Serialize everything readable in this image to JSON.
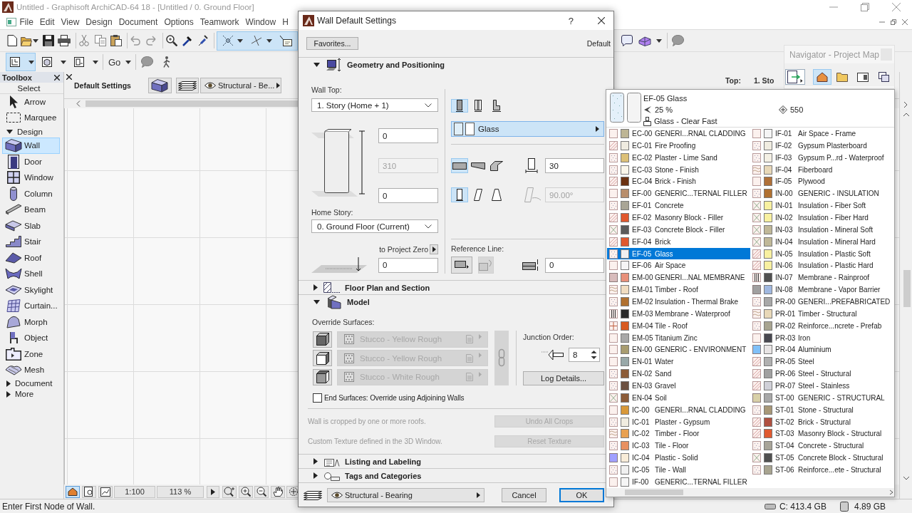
{
  "window": {
    "title": "Untitled - Graphisoft ArchiCAD-64 18 - [Untitled / 0. Ground Floor]"
  },
  "menu_bar": [
    {
      "label": "File"
    },
    {
      "label": "Edit"
    },
    {
      "label": "View"
    },
    {
      "label": "Design"
    },
    {
      "label": "Document"
    },
    {
      "label": "Options"
    },
    {
      "label": "Teamwork"
    },
    {
      "label": "Window"
    },
    {
      "label": "H"
    }
  ],
  "toolbar": {
    "snap_tools_active": true,
    "views": [
      {
        "selected": true
      },
      {
        "selected": false
      },
      {
        "selected": false
      }
    ],
    "go_label": "Go"
  },
  "toolbox": {
    "title": "Toolbox",
    "select_label": "Select",
    "select_tools": [
      {
        "label": "Arrow",
        "selected": false
      },
      {
        "label": "Marquee",
        "selected": false
      }
    ],
    "groups": [
      {
        "label": "Design",
        "expanded": true,
        "tools": [
          {
            "label": "Wall",
            "selected": true
          },
          {
            "label": "Door",
            "selected": false
          },
          {
            "label": "Window",
            "selected": false
          },
          {
            "label": "Column",
            "selected": false
          },
          {
            "label": "Beam",
            "selected": false
          },
          {
            "label": "Slab",
            "selected": false
          },
          {
            "label": "Stair",
            "selected": false
          },
          {
            "label": "Roof",
            "selected": false
          },
          {
            "label": "Shell",
            "selected": false
          },
          {
            "label": "Skylight",
            "selected": false
          },
          {
            "label": "Curtain...",
            "selected": false
          },
          {
            "label": "Morph",
            "selected": false
          },
          {
            "label": "Object",
            "selected": false
          },
          {
            "label": "Zone",
            "selected": false
          },
          {
            "label": "Mesh",
            "selected": false
          }
        ]
      },
      {
        "label": "Document",
        "expanded": false
      },
      {
        "label": "More",
        "expanded": false
      }
    ]
  },
  "info_box": {
    "title": "Default Settings",
    "layer": "Structural - Be...",
    "top_label": "Top:",
    "top_value": "1. Sto"
  },
  "view_controls": {
    "modes": [
      {
        "selected": true
      },
      {
        "selected": false
      },
      {
        "selected": false
      }
    ],
    "scale": "1:100",
    "zoom": "113 %"
  },
  "navigator": {
    "title": "Navigator - Project Map",
    "tabs": [
      {
        "selected": true
      },
      {
        "selected": false
      },
      {
        "selected": false
      },
      {
        "selected": false
      }
    ]
  },
  "status_bar": {
    "message": "Enter First Node of Wall.",
    "disk": "C: 413.4 GB",
    "memory": "4.89 GB"
  },
  "dialog": {
    "title": "Wall Default Settings",
    "help_button": "?",
    "favorites_button": "Favorites...",
    "preset": "Default",
    "sections": [
      {
        "kind": "geometry",
        "title": "Geometry and Positioning",
        "expanded": true,
        "wall_top_label": "Wall Top:",
        "wall_top": "1. Story (Home + 1)",
        "top_offset": {
          "value": "0",
          "disabled": false
        },
        "height": {
          "value": "310",
          "disabled": true
        },
        "bottom_offset": {
          "value": "0",
          "disabled": false
        },
        "home_story_label": "Home Story:",
        "home_story": "0. Ground Floor (Current)",
        "project_zero_label": "to Project Zero",
        "base_elevation": {
          "value": "0",
          "disabled": false
        },
        "structure": [
          {
            "selected": true
          },
          {
            "selected": false
          },
          {
            "selected": false
          }
        ],
        "material": {
          "value": "Glass",
          "open": true
        },
        "profile": [
          {
            "selected": true
          },
          {
            "selected": false
          },
          {
            "selected": false
          }
        ],
        "thickness": {
          "value": "30",
          "disabled": false
        },
        "slant": [
          {
            "selected": true
          },
          {
            "selected": false
          },
          {
            "selected": false
          }
        ],
        "angle": {
          "value": "90.00°",
          "disabled": true
        },
        "reference_line_label": "Reference Line:",
        "reference_offset": {
          "value": "0",
          "disabled": false
        }
      },
      {
        "kind": "floor_plan",
        "title": "Floor Plan and Section",
        "expanded": false
      },
      {
        "kind": "model",
        "title": "Model",
        "expanded": true,
        "override_label": "Override Surfaces:",
        "surfaces": [
          {
            "value": "Stucco - Yellow Rough",
            "disabled": true
          },
          {
            "value": "Stucco - Yellow Rough",
            "disabled": true
          },
          {
            "value": "Stucco - White Rough",
            "disabled": true
          }
        ],
        "junction_label": "Junction Order:",
        "junction_order": "8",
        "log_button": "Log Details...",
        "end_surfaces": {
          "label": "End Surfaces: Override using Adjoining Walls",
          "checked": false
        },
        "notes": [
          {
            "text": "Wall is cropped by one or more roofs.",
            "button": "Undo All Crops",
            "disabled": true
          },
          {
            "text": "Custom Texture defined in the 3D Window.",
            "button": "Reset Texture",
            "disabled": true
          }
        ]
      },
      {
        "kind": "listing",
        "title": "Listing and Labeling",
        "expanded": false
      },
      {
        "kind": "tags",
        "title": "Tags and Categories",
        "expanded": false
      }
    ],
    "footer": {
      "layer": "Structural - Bearing",
      "buttons": [
        {
          "label": "Cancel",
          "default": false
        },
        {
          "label": "OK",
          "default": true
        }
      ]
    }
  },
  "material_popup": {
    "preview": {
      "name": "EF-05 Glass",
      "transparency": "25 %",
      "priority": "550",
      "surface": "Glass - Clear Fast"
    },
    "columns": [
      [
        {
          "code": "EC-00",
          "name": "GENERI...RNAL CLADDING",
          "color": "#bdb594",
          "selected": false
        },
        {
          "code": "EC-01",
          "name": "Fire Proofing",
          "color": "#efebe0",
          "selected": false
        },
        {
          "code": "EC-02",
          "name": "Plaster - Lime Sand",
          "color": "#dcc078",
          "selected": false
        },
        {
          "code": "EC-03",
          "name": "Stone - Finish",
          "color": "#faf6ea",
          "selected": false
        },
        {
          "code": "EC-04",
          "name": "Brick - Finish",
          "color": "#6b3212",
          "selected": false
        },
        {
          "code": "EF-00",
          "name": "GENERIC...TERNAL FILLER",
          "color": "#b88e6c",
          "selected": false
        },
        {
          "code": "EF-01",
          "name": "Concrete",
          "color": "#a9a596",
          "selected": false
        },
        {
          "code": "EF-02",
          "name": "Masonry Block - Filler",
          "color": "#e0582e",
          "selected": false
        },
        {
          "code": "EF-03",
          "name": "Concrete Block - Filler",
          "color": "#5a5a5a",
          "selected": false
        },
        {
          "code": "EF-04",
          "name": "Brick",
          "color": "#e0582e",
          "selected": false
        },
        {
          "code": "EF-05",
          "name": "Glass",
          "color": "#f0f0f0",
          "selected": true
        },
        {
          "code": "EF-06",
          "name": "Air Space",
          "color": "#f5f5f5",
          "selected": false
        },
        {
          "code": "EM-00",
          "name": "GENERI...NAL MEMBRANE",
          "color": "#e8907a",
          "selected": false
        },
        {
          "code": "EM-01",
          "name": "Timber - Roof",
          "color": "#f0dcc0",
          "selected": false
        },
        {
          "code": "EM-02",
          "name": "Insulation - Thermal Brake",
          "color": "#b07030",
          "selected": false
        },
        {
          "code": "EM-03",
          "name": "Membrane - Waterproof",
          "color": "#2a2a2a",
          "selected": false
        },
        {
          "code": "EM-04",
          "name": "Tile - Roof",
          "color": "#d85a20",
          "selected": false
        },
        {
          "code": "EM-05",
          "name": "Titanium Zinc",
          "color": "#a8a8a8",
          "selected": false
        },
        {
          "code": "EN-00",
          "name": "GENERIC - ENVIRONMENT",
          "color": "#a89c70",
          "selected": false
        },
        {
          "code": "EN-01",
          "name": "Water",
          "color": "#98a8a8",
          "selected": false
        },
        {
          "code": "EN-02",
          "name": "Sand",
          "color": "#8c5c38",
          "selected": false
        },
        {
          "code": "EN-03",
          "name": "Gravel",
          "color": "#6c5040",
          "selected": false
        },
        {
          "code": "EN-04",
          "name": "Soil",
          "color": "#8c5c38",
          "selected": false
        },
        {
          "code": "IC-00",
          "name": "GENERI...RNAL CLADDING",
          "color": "#d89838",
          "selected": false
        },
        {
          "code": "IC-01",
          "name": "Plaster - Gypsum",
          "color": "#f0ece0",
          "selected": false
        },
        {
          "code": "IC-02",
          "name": "Timber - Floor",
          "color": "#e8a050",
          "selected": false
        },
        {
          "code": "IC-03",
          "name": "Tile - Floor",
          "color": "#e89060",
          "selected": false
        },
        {
          "code": "IC-04",
          "name": "Plastic - Solid",
          "color": "#f8ecd8",
          "selected": false
        },
        {
          "code": "IC-05",
          "name": "Tile - Wall",
          "color": "#f0f0f0",
          "selected": false
        },
        {
          "code": "IF-00",
          "name": "GENERIC...TERNAL FILLER",
          "color": "#f5f5f5",
          "selected": false
        }
      ],
      [
        {
          "code": "IF-01",
          "name": "Air Space - Frame",
          "color": "#f5f5f5",
          "selected": false
        },
        {
          "code": "IF-02",
          "name": "Gypsum Plasterboard",
          "color": "#f0ece0",
          "selected": false
        },
        {
          "code": "IF-03",
          "name": "Gypsum P...rd - Waterproof",
          "color": "#f4f0e4",
          "selected": false
        },
        {
          "code": "IF-04",
          "name": "Fiberboard",
          "color": "#e8d8b8",
          "selected": false
        },
        {
          "code": "IF-05",
          "name": "Plywood",
          "color": "#b07038",
          "selected": false
        },
        {
          "code": "IN-00",
          "name": "GENERIC - INSULATION",
          "color": "#b07030",
          "selected": false
        },
        {
          "code": "IN-01",
          "name": "Insulation - Fiber Soft",
          "color": "#f8f0a0",
          "selected": false
        },
        {
          "code": "IN-02",
          "name": "Insulation - Fiber Hard",
          "color": "#f8f0a0",
          "selected": false
        },
        {
          "code": "IN-03",
          "name": "Insulation - Mineral Soft",
          "color": "#c0b898",
          "selected": false
        },
        {
          "code": "IN-04",
          "name": "Insulation - Mineral Hard",
          "color": "#c0b898",
          "selected": false
        },
        {
          "code": "IN-05",
          "name": "Insulation - Plastic Soft",
          "color": "#f8f0a0",
          "selected": false
        },
        {
          "code": "IN-06",
          "name": "Insulation - Plastic Hard",
          "color": "#f8f0a0",
          "selected": false
        },
        {
          "code": "IN-07",
          "name": "Membrane - Rainproof",
          "color": "#505050",
          "selected": false
        },
        {
          "code": "IN-08",
          "name": "Membrane - Vapor Barrier",
          "color": "#a0b8e0",
          "selected": false
        },
        {
          "code": "PR-00",
          "name": "GENERI...PREFABRICATED",
          "color": "#a8a8a8",
          "selected": false
        },
        {
          "code": "PR-01",
          "name": "Timber - Structural",
          "color": "#e8d8b8",
          "selected": false
        },
        {
          "code": "PR-02",
          "name": "Reinforce...ncrete - Prefab",
          "color": "#a8a490",
          "selected": false
        },
        {
          "code": "PR-03",
          "name": "Iron",
          "color": "#484850",
          "selected": false
        },
        {
          "code": "PR-04",
          "name": "Aluminium",
          "color": "#e8e4e4",
          "selected": false
        },
        {
          "code": "PR-05",
          "name": "Steel",
          "color": "#b0b0b0",
          "selected": false
        },
        {
          "code": "PR-06",
          "name": "Steel - Structural",
          "color": "#a0a0a0",
          "selected": false
        },
        {
          "code": "PR-07",
          "name": "Steel - Stainless",
          "color": "#d0d0d8",
          "selected": false
        },
        {
          "code": "ST-00",
          "name": "GENERIC - STRUCTURAL",
          "color": "#a8a8a8",
          "selected": false
        },
        {
          "code": "ST-01",
          "name": "Stone - Structural",
          "color": "#a89878",
          "selected": false
        },
        {
          "code": "ST-02",
          "name": "Brick - Structural",
          "color": "#b05040",
          "selected": false
        },
        {
          "code": "ST-03",
          "name": "Masonry Block - Structural",
          "color": "#e05a30",
          "selected": false
        },
        {
          "code": "ST-04",
          "name": "Concrete - Structural",
          "color": "#a8a498",
          "selected": false
        },
        {
          "code": "ST-05",
          "name": "Concrete Block - Structural",
          "color": "#505050",
          "selected": false
        },
        {
          "code": "ST-06",
          "name": "Reinforce...ete - Structural",
          "color": "#a8a490",
          "selected": false
        }
      ]
    ]
  }
}
